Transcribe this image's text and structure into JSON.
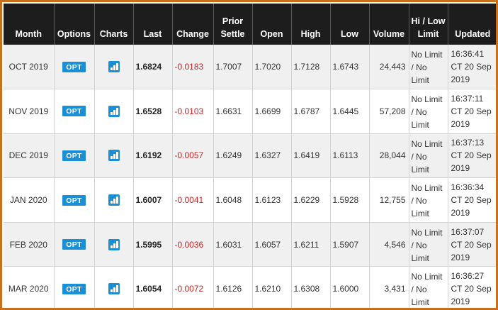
{
  "headers": {
    "month": "Month",
    "options": "Options",
    "charts": "Charts",
    "last": "Last",
    "change": "Change",
    "prior_settle": "Prior Settle",
    "open": "Open",
    "high": "High",
    "low": "Low",
    "volume": "Volume",
    "hi_low_limit": "Hi / Low Limit",
    "updated": "Updated"
  },
  "option_label": "OPT",
  "chart_icon": "bar-chart-icon",
  "colors": {
    "border_accent": "#c8701e",
    "header_bg": "#1d1d1d",
    "negative_change": "#cc1f1f",
    "button_blue": "#1a8fd6"
  },
  "rows": [
    {
      "month": "OCT 2019",
      "opt": "OPT",
      "last": "1.6824",
      "change": "-0.0183",
      "prior": "1.7007",
      "open": "1.7020",
      "high": "1.7128",
      "low": "1.6743",
      "volume": "24,443",
      "limit": "No Limit / No Limit",
      "updated": "16:36:41 CT 20 Sep 2019"
    },
    {
      "month": "NOV 2019",
      "opt": "OPT",
      "last": "1.6528",
      "change": "-0.0103",
      "prior": "1.6631",
      "open": "1.6699",
      "high": "1.6787",
      "low": "1.6445",
      "volume": "57,208",
      "limit": "No Limit / No Limit",
      "updated": "16:37:11 CT 20 Sep 2019"
    },
    {
      "month": "DEC 2019",
      "opt": "OPT",
      "last": "1.6192",
      "change": "-0.0057",
      "prior": "1.6249",
      "open": "1.6327",
      "high": "1.6419",
      "low": "1.6113",
      "volume": "28,044",
      "limit": "No Limit / No Limit",
      "updated": "16:37:13 CT 20 Sep 2019"
    },
    {
      "month": "JAN 2020",
      "opt": "OPT",
      "last": "1.6007",
      "change": "-0.0041",
      "prior": "1.6048",
      "open": "1.6123",
      "high": "1.6229",
      "low": "1.5928",
      "volume": "12,755",
      "limit": "No Limit / No Limit",
      "updated": "16:36:34 CT 20 Sep 2019"
    },
    {
      "month": "FEB 2020",
      "opt": "OPT",
      "last": "1.5995",
      "change": "-0.0036",
      "prior": "1.6031",
      "open": "1.6057",
      "high": "1.6211",
      "low": "1.5907",
      "volume": "4,546",
      "limit": "No Limit / No Limit",
      "updated": "16:37:07 CT 20 Sep 2019"
    },
    {
      "month": "MAR 2020",
      "opt": "OPT",
      "last": "1.6054",
      "change": "-0.0072",
      "prior": "1.6126",
      "open": "1.6210",
      "high": "1.6308",
      "low": "1.6000",
      "volume": "3,431",
      "limit": "No Limit / No Limit",
      "updated": "16:36:27 CT 20 Sep 2019"
    }
  ]
}
